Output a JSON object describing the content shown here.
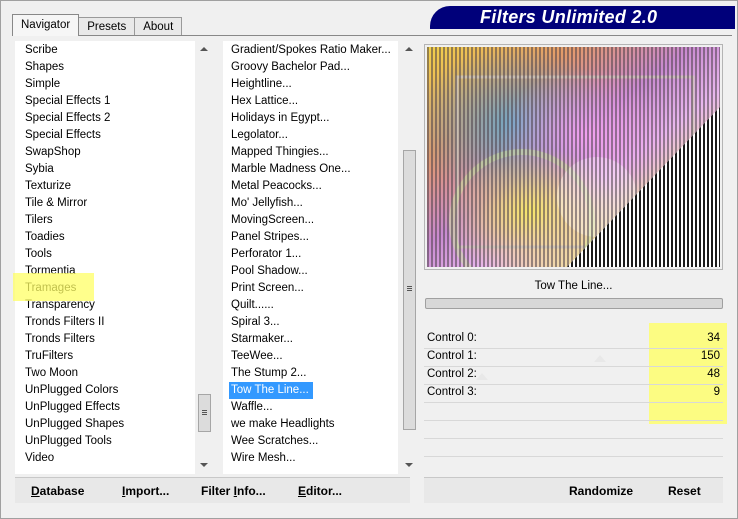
{
  "window": {
    "title": "Filters Unlimited 2.0",
    "accent": "#00007a"
  },
  "tabs": [
    {
      "label": "Navigator",
      "active": true
    },
    {
      "label": "Presets",
      "active": false
    },
    {
      "label": "About",
      "active": false
    }
  ],
  "categories": {
    "items": [
      "Scribe",
      "Shapes",
      "Simple",
      "Special Effects 1",
      "Special Effects 2",
      "Special Effects",
      "SwapShop",
      "Sybia",
      "Texturize",
      "Tile & Mirror",
      "Tilers",
      "Toadies",
      "Tools",
      "Tormentia",
      "Tramages",
      "Transparency",
      "Tronds Filters II",
      "Tronds Filters",
      "TruFilters",
      "Two Moon",
      "UnPlugged Colors",
      "UnPlugged Effects",
      "UnPlugged Shapes",
      "UnPlugged Tools",
      "Video"
    ],
    "highlighted": "Tramages"
  },
  "filters": {
    "items": [
      "Gradient/Spokes Ratio Maker...",
      "Groovy Bachelor Pad...",
      "Heightline...",
      "Hex Lattice...",
      "Holidays in Egypt...",
      "Legolator...",
      "Mapped Thingies...",
      "Marble Madness One...",
      "Metal Peacocks...",
      "Mo' Jellyfish...",
      "MovingScreen...",
      "Panel Stripes...",
      "Perforator 1...",
      "Pool Shadow...",
      "Print Screen...",
      "Quilt......",
      "Spiral 3...",
      "Starmaker...",
      "TeeWee...",
      "The Stump 2...",
      "Tow The Line...",
      "Waffle...",
      "we make Headlights",
      "Wee Scratches...",
      "Wire Mesh..."
    ],
    "selected": "Tow The Line..."
  },
  "current_filter": "Tow The Line...",
  "controls": [
    {
      "label": "Control 0:",
      "value": "34"
    },
    {
      "label": "Control 1:",
      "value": "150"
    },
    {
      "label": "Control 2:",
      "value": "48"
    },
    {
      "label": "Control 3:",
      "value": "9"
    }
  ],
  "buttons": {
    "database": {
      "label_ul": "D",
      "label_rest": "atabase"
    },
    "import": {
      "label_ul": "I",
      "label_rest": "mport..."
    },
    "filter_info": {
      "label_pre": "Filter ",
      "label_ul": "I",
      "label_rest": "nfo..."
    },
    "editor": {
      "label_ul": "E",
      "label_rest": "ditor..."
    },
    "randomize": "Randomize",
    "reset": "Reset"
  },
  "highlight_color": "#ffff66",
  "selection_color": "#3399ff"
}
